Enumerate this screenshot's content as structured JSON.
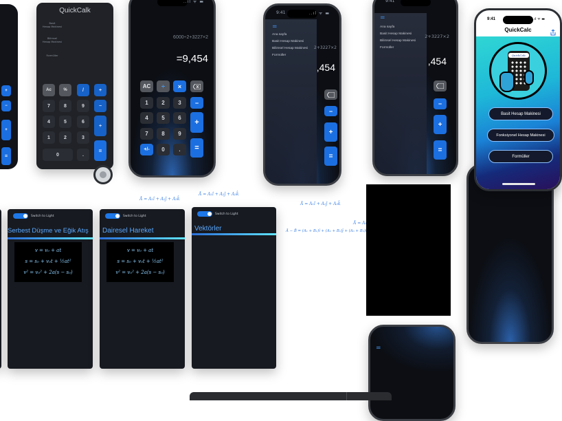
{
  "app": {
    "title": "QuickCalk",
    "title_light": "QuickCalc",
    "logo_text": "QuickCalc"
  },
  "sidebar_labels": {
    "basic": "Basit\nHesap Makinesi",
    "scientific": "Bilimsel\nHesap Makinesi",
    "formulas": "Formüller"
  },
  "calculator": {
    "expression": "6000÷2+3227×2",
    "expression_partial": "2+3227×2",
    "result": "=9,454",
    "result_partial": ",454",
    "keys": {
      "ac": "AC",
      "ac_small": "Ac",
      "divide": "÷",
      "multiply": "×",
      "minus": "−",
      "plus": "+",
      "equals": "=",
      "sign": "+/-",
      "dot": ".",
      "zero": "0",
      "one": "1",
      "two": "2",
      "three": "3",
      "four": "4",
      "five": "5",
      "six": "6",
      "seven": "7",
      "eight": "8",
      "nine": "9",
      "slash": "/",
      "percent": "%"
    }
  },
  "menu": {
    "icon": "=",
    "items": [
      "Ana sayfa",
      "Basit Hesap Makinesi",
      "Bilimsel Hesap Makinesi",
      "Formüller"
    ]
  },
  "status": {
    "time": "9:41",
    "signal": "..ıl ᯤ ▬"
  },
  "home_screen": {
    "buttons": [
      "Basit Hesap Makinesi",
      "Fonksiyonel Hesap Makinesi",
      "Formüller"
    ],
    "share_icon": "share-icon"
  },
  "physics": {
    "toggle_label": "Switch to Light",
    "free_fall_title": "Serbest Düşme ve Eğik Atış",
    "circular_title": "Dairesel Hareket",
    "vectors_title": "Vektörler",
    "equations": [
      "v = v₀ + at",
      "s = s₀ + v₀t + ½at²",
      "v² = v₀² + 2a(s − s₀)"
    ]
  },
  "formulas": {
    "f1": "Ā = A₁î + A₂ĵ + A₃k̂",
    "f2": "Ā = A₁î + A₂ĵ + A₃k̂",
    "f3": "Ā = A₁î + A₂ĵ + A₃k̂",
    "f4": "Ā = A₁î + A₂ĵ + A₃k̂",
    "f5": "Ā − B̄ = (A₁ + B₁)î + (A₂ + B₂)ĵ + (A₃ + B₃)k̂"
  },
  "colors": {
    "accent_blue": "#1c6fe0",
    "panel_bg": "#171a20",
    "title_blue": "#5aa8ff",
    "formula_blue": "#3d82e6"
  }
}
